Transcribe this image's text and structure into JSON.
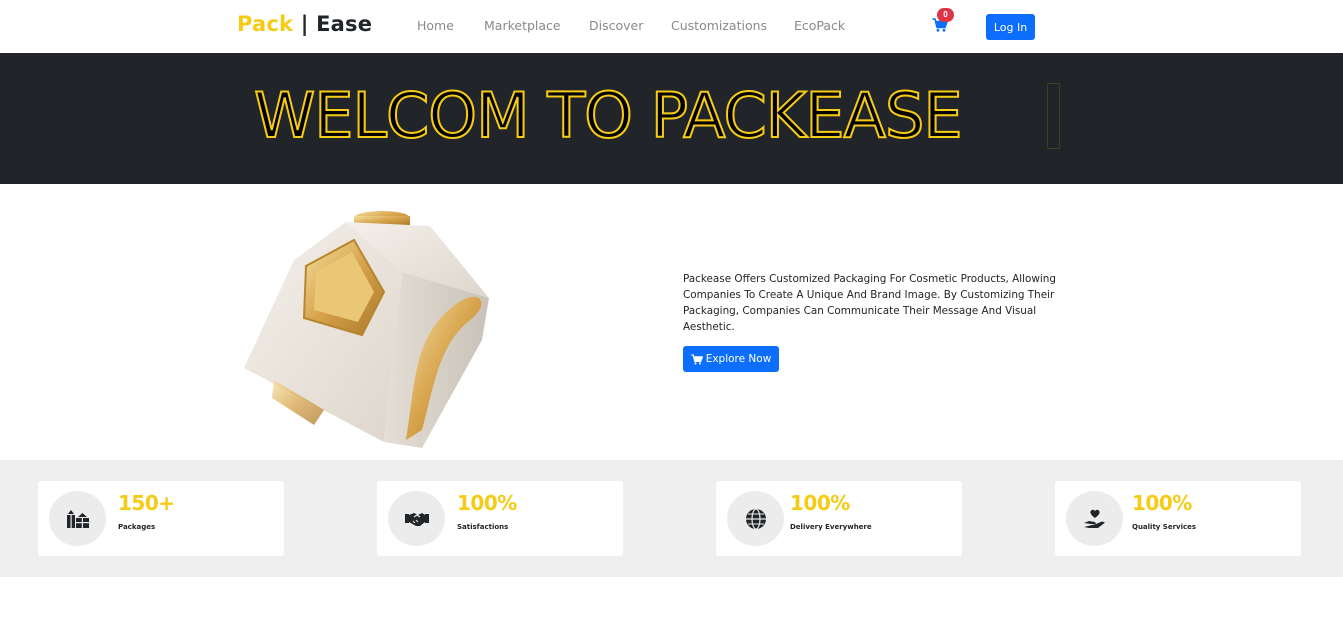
{
  "nav": {
    "brand_left": "Pack",
    "brand_sep": " | ",
    "brand_right": "Ease",
    "links": [
      "Home",
      "Marketplace",
      "Discover",
      "Customizations",
      "EcoPack"
    ],
    "cart_count": "0",
    "login_label": "Log In"
  },
  "hero": {
    "title": "WELCOM TO PACKEASE"
  },
  "about": {
    "text": "Packease Offers Customized Packaging For Cosmetic Products, Allowing Companies To Create A Unique And Brand Image. By Customizing Their Packaging, Companies Can Communicate Their Message And Visual Aesthetic.",
    "button_label": "Explore Now"
  },
  "stats": [
    {
      "value": "150+",
      "label": "Packages",
      "icon": "gifts-icon"
    },
    {
      "value": "100%",
      "label": "Satisfactions",
      "icon": "handshake-icon"
    },
    {
      "value": "100%",
      "label": "Delivery Everywhere",
      "icon": "globe-icon"
    },
    {
      "value": "100%",
      "label": "Quality Services",
      "icon": "hand-holding-heart-icon"
    }
  ],
  "colors": {
    "brand_yellow": "#f6cb16",
    "primary_blue": "#0d6efd",
    "dark": "#212529",
    "badge_red": "#dc3545"
  }
}
